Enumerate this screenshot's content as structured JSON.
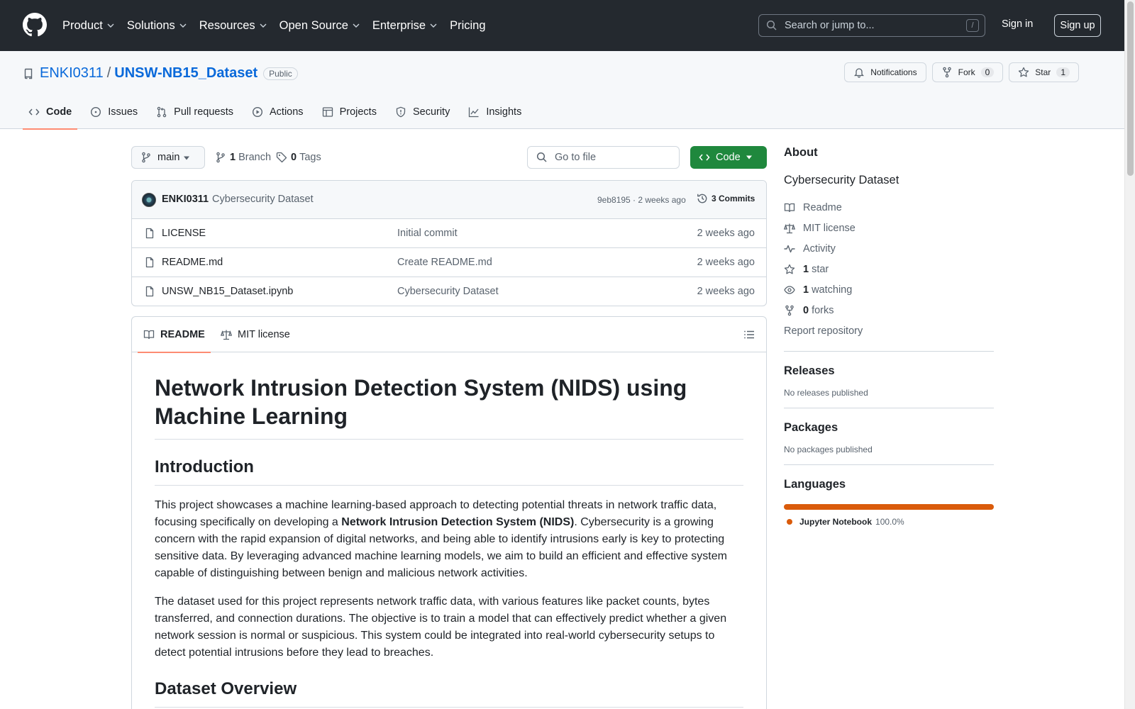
{
  "header": {
    "nav": [
      "Product",
      "Solutions",
      "Resources",
      "Open Source",
      "Enterprise",
      "Pricing"
    ],
    "search_placeholder": "Search or jump to...",
    "search_key": "/",
    "sign_in": "Sign in",
    "sign_up": "Sign up"
  },
  "repo": {
    "owner": "ENKI0311",
    "separator": "/",
    "name": "UNSW-NB15_Dataset",
    "visibility": "Public",
    "notifications": "Notifications",
    "fork": "Fork",
    "fork_count": "0",
    "star": "Star",
    "star_count": "1"
  },
  "tabs": [
    "Code",
    "Issues",
    "Pull requests",
    "Actions",
    "Projects",
    "Security",
    "Insights"
  ],
  "toolbar": {
    "branch": "main",
    "branch_count": "1",
    "branch_label": "Branch",
    "tag_count": "0",
    "tag_label": "Tags",
    "goto_file": "Go to file",
    "code_button": "Code"
  },
  "commit": {
    "author": "ENKI0311",
    "message": "Cybersecurity Dataset",
    "hash_time": "9eb8195 · 2 weeks ago",
    "commits": "3 Commits"
  },
  "files": [
    {
      "name": "LICENSE",
      "message": "Initial commit",
      "date": "2 weeks ago"
    },
    {
      "name": "README.md",
      "message": "Create README.md",
      "date": "2 weeks ago"
    },
    {
      "name": "UNSW_NB15_Dataset.ipynb",
      "message": "Cybersecurity Dataset",
      "date": "2 weeks ago"
    }
  ],
  "readme": {
    "tab_readme": "README",
    "tab_license": "MIT license",
    "title": "Network Intrusion Detection System (NIDS) using Machine Learning",
    "h_intro": "Introduction",
    "p1_before": "This project showcases a machine learning-based approach to detecting potential threats in network traffic data, focusing specifically on developing a ",
    "p1_bold": "Network Intrusion Detection System (NIDS)",
    "p1_after": ". Cybersecurity is a growing concern with the rapid expansion of digital networks, and being able to identify intrusions early is key to protecting sensitive data. By leveraging advanced machine learning models, we aim to build an efficient and effective system capable of distinguishing between benign and malicious network activities.",
    "p2": "The dataset used for this project represents network traffic data, with various features like packet counts, bytes transferred, and connection durations. The objective is to train a model that can effectively predict whether a given network session is normal or suspicious. This system could be integrated into real-world cybersecurity setups to detect potential intrusions before they lead to breaches.",
    "h_dataset": "Dataset Overview"
  },
  "sidebar": {
    "about_title": "About",
    "description": "Cybersecurity Dataset",
    "links": {
      "readme": "Readme",
      "license": "MIT license",
      "activity": "Activity",
      "stars_count": "1",
      "stars_label": "star",
      "watching_count": "1",
      "watching_label": "watching",
      "forks_count": "0",
      "forks_label": "forks",
      "report": "Report repository"
    },
    "releases_title": "Releases",
    "releases_text": "No releases published",
    "packages_title": "Packages",
    "packages_text": "No packages published",
    "languages_title": "Languages",
    "language": {
      "name": "Jupyter Notebook",
      "percent": "100.0%",
      "color": "#DA5B0B"
    }
  }
}
